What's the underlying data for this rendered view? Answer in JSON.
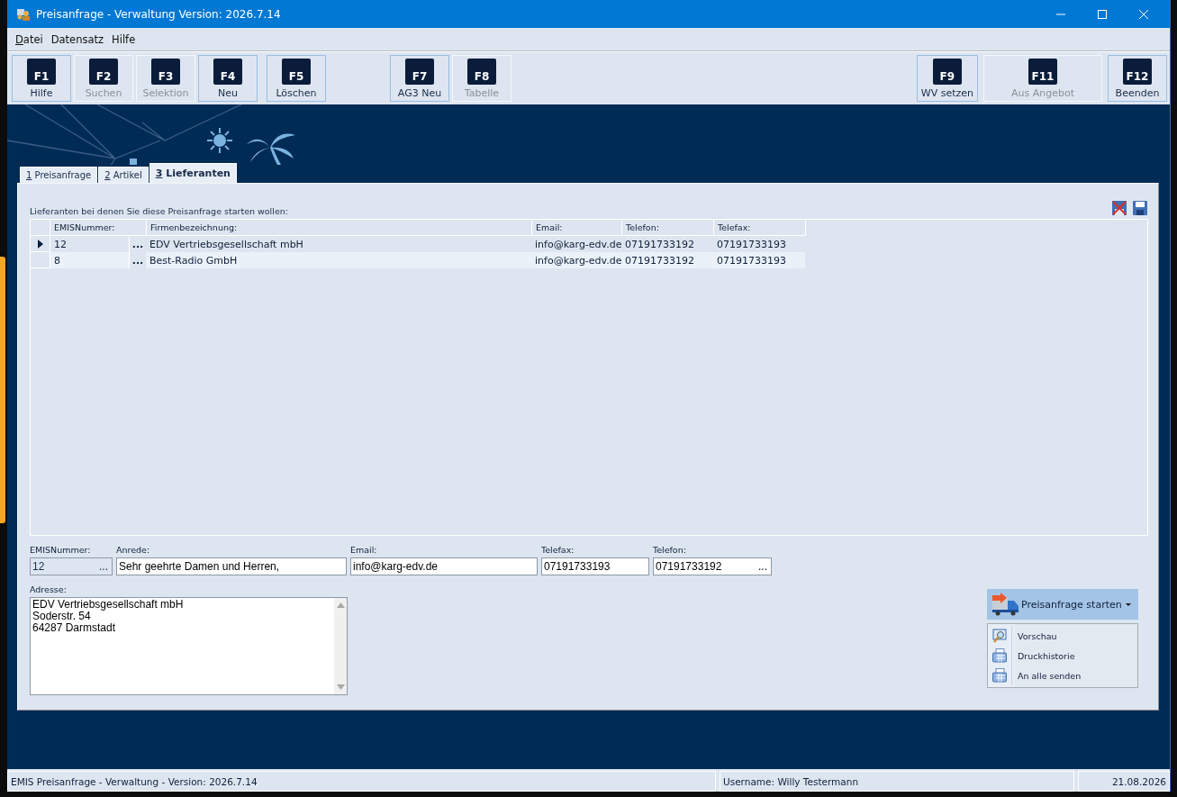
{
  "window": {
    "title": "Preisanfrage - Verwaltung Version: 2026.7.14"
  },
  "menu": [
    {
      "label": "Datei",
      "mnemonic": true
    },
    {
      "label": "Datensatz",
      "mnemonic": false
    },
    {
      "label": "Hilfe",
      "mnemonic": false
    }
  ],
  "toolbar": {
    "groups": [
      [
        {
          "key": "F1",
          "label": "Hilfe",
          "disabled": false
        },
        {
          "key": "F2",
          "label": "Suchen",
          "disabled": true
        },
        {
          "key": "F3",
          "label": "Selektion",
          "disabled": true
        },
        {
          "key": "F4",
          "label": "Neu",
          "disabled": false
        }
      ],
      [
        {
          "key": "F5",
          "label": "Löschen",
          "disabled": false
        }
      ],
      [
        {
          "key": "F7",
          "label": "AG3 Neu",
          "disabled": false
        },
        {
          "key": "F8",
          "label": "Tabelle",
          "disabled": true
        }
      ],
      [
        {
          "key": "F9",
          "label": "WV setzen",
          "disabled": false
        },
        {
          "key": "F11",
          "label": "Aus Angebot",
          "disabled": true
        },
        {
          "key": "F12",
          "label": "Beenden",
          "disabled": false
        }
      ]
    ]
  },
  "background": {
    "kind": "picture"
  },
  "tabs": [
    {
      "label": "1 Preisanfrage",
      "selected": false
    },
    {
      "label": "2 Artikel",
      "selected": false
    },
    {
      "label": "3 Lieferanten",
      "selected": true
    }
  ],
  "grid": {
    "caption": "Lieferanten bei denen Sie diese Preisanfrage starten wollen:",
    "columns": [
      "EMISNummer:",
      "Firmenbezeichnung:",
      "Email:",
      "Telefon:",
      "Telefax:"
    ],
    "rows": [
      {
        "current": true,
        "lookup": "...",
        "cells": [
          "12",
          "EDV Vertriebsgesellschaft mbH",
          "info@karg-edv.de",
          "07191733192",
          "07191733193"
        ]
      },
      {
        "current": false,
        "lookup": "...",
        "cells": [
          "8",
          "Best-Radio GmbH",
          "info@karg-edv.de",
          "07191733192",
          "07191733193"
        ]
      }
    ]
  },
  "form": {
    "fields": [
      {
        "label": "EMISNummer:",
        "value": "12",
        "readonly": true,
        "lookup": "..."
      },
      {
        "label": "Anrede:",
        "value": "Sehr geehrte Damen und Herren,",
        "readonly": false
      },
      {
        "label": "Email:",
        "value": "info@karg-edv.de",
        "readonly": false
      },
      {
        "label": "Telefax:",
        "value": "07191733193",
        "readonly": false
      },
      {
        "label": "Telefon:",
        "value": "07191733192",
        "readonly": false,
        "lookup": "..."
      }
    ],
    "address": {
      "label": "Adresse:",
      "lines": [
        "EDV Vertriebsgesellschaft mbH",
        "Soderstr. 54",
        "64287 Darmstadt"
      ]
    }
  },
  "action": {
    "label": "Preisanfrage starten",
    "menu": [
      {
        "label": "Vorschau",
        "kind": "preview"
      },
      {
        "label": "Druckhistorie",
        "kind": "print"
      },
      {
        "label": "An alle senden",
        "kind": "print"
      }
    ]
  },
  "status_bar": [
    "EMIS Preisanfrage - Verwaltung - Version: 2026.7.14",
    "Username: Willy Testermann",
    "21.08.2026"
  ]
}
